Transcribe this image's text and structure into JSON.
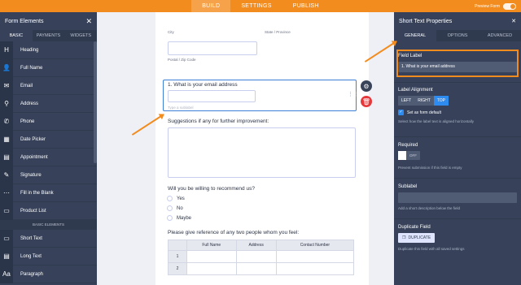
{
  "topbar": {
    "tabs": [
      "BUILD",
      "SETTINGS",
      "PUBLISH"
    ],
    "preview_label": "Preview Form"
  },
  "left_panel": {
    "title": "Form Elements",
    "close": "✕",
    "tabs": [
      "BASIC",
      "PAYMENTS",
      "WIDGETS"
    ],
    "items": [
      {
        "icon": "H",
        "label": "Heading"
      },
      {
        "icon": "👤",
        "label": "Full Name"
      },
      {
        "icon": "✉",
        "label": "Email"
      },
      {
        "icon": "⚲",
        "label": "Address"
      },
      {
        "icon": "✆",
        "label": "Phone"
      },
      {
        "icon": "▦",
        "label": "Date Picker"
      },
      {
        "icon": "▤",
        "label": "Appointment"
      },
      {
        "icon": "✎",
        "label": "Signature"
      },
      {
        "icon": "⋯",
        "label": "Fill in the Blank"
      },
      {
        "icon": "▭",
        "label": "Product List"
      }
    ],
    "section_label": "BASIC ELEMENTS",
    "basic_items": [
      {
        "icon": "▭",
        "label": "Short Text"
      },
      {
        "icon": "▤",
        "label": "Long Text"
      },
      {
        "icon": "Aa",
        "label": "Paragraph"
      }
    ]
  },
  "form": {
    "city_label": "City",
    "state_label": "State / Province",
    "postal_label": "Postal / Zip Code",
    "q1_label": "1. What is your email address",
    "q1_sublabel": "Type a sublabel",
    "q2_label": "Suggestions if any for further improvement:",
    "q3_label": "Will you be willing to recommend us?",
    "q3_options": [
      "Yes",
      "No",
      "Maybe"
    ],
    "q4_label": "Please give reference of any two people whom you feel:",
    "q4_columns": [
      "Full Name",
      "Address",
      "Contact Number"
    ],
    "q4_rows": [
      "1",
      "2"
    ]
  },
  "right_panel": {
    "title": "Short Text Properties",
    "close": "✕",
    "tabs": [
      "GENERAL",
      "OPTIONS",
      "ADVANCED"
    ],
    "field_label_title": "Field Label",
    "field_label_value": "1. What is your email address",
    "label_alignment_title": "Label Alignment",
    "alignment_options": [
      "LEFT",
      "RIGHT",
      "TOP"
    ],
    "alignment_selected": "TOP",
    "set_default_label": "Set as form default",
    "alignment_help": "Select how the label text is aligned horizontally",
    "required_title": "Required",
    "required_state": "OFF",
    "required_help": "Prevent submission if this field is empty",
    "sublabel_title": "Sublabel",
    "sublabel_help": "Add a short description below the field",
    "duplicate_title": "Duplicate Field",
    "duplicate_button": "DUPLICATE",
    "duplicate_help": "Duplicate this field with all saved settings"
  },
  "colors": {
    "accent": "#f28c1f",
    "panel": "#37425a",
    "selection": "#3b7fd9",
    "primary_blue": "#2e8bf0",
    "delete_red": "#e5383b"
  }
}
